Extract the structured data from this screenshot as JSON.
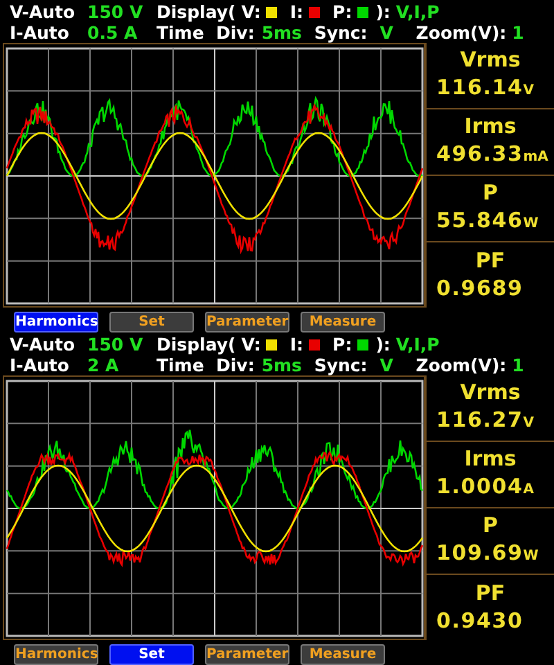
{
  "panels": [
    {
      "v_range_label": "V-Auto",
      "v_range": "150 V",
      "display_open": "Display(",
      "legend": [
        {
          "label": "V:",
          "color": "#f0e000"
        },
        {
          "label": "I:",
          "color": "#e80000"
        },
        {
          "label": "P:",
          "color": "#00d800"
        }
      ],
      "display_close": "):",
      "display_value": "V,I,P",
      "i_range_label": "I-Auto",
      "i_range": "0.5 A",
      "time_div_label": "Time  Div:",
      "time_div": "5ms",
      "sync_label": "Sync:",
      "sync": "V",
      "zoom_label": "Zoom(V):",
      "zoom": "1",
      "readings": [
        {
          "name": "Vrms",
          "value": "116.14",
          "unit": "V"
        },
        {
          "name": "Irms",
          "value": "496.33",
          "unit": "mA"
        },
        {
          "name": "P",
          "value": "55.846",
          "unit": "W"
        },
        {
          "name": "PF",
          "value": "0.9689"
        }
      ],
      "buttons": [
        {
          "label": "Harmonics",
          "selected": true
        },
        {
          "label": "Set",
          "selected": false
        },
        {
          "label": "Parameter",
          "selected": false
        },
        {
          "label": "Measure",
          "selected": false
        }
      ]
    },
    {
      "v_range_label": "V-Auto",
      "v_range": "150 V",
      "display_open": "Display(",
      "legend": [
        {
          "label": "V:",
          "color": "#f0e000"
        },
        {
          "label": "I:",
          "color": "#e80000"
        },
        {
          "label": "P:",
          "color": "#00d800"
        }
      ],
      "display_close": "):",
      "display_value": "V,I,P",
      "i_range_label": "I-Auto",
      "i_range": "2 A",
      "time_div_label": "Time  Div:",
      "time_div": "5ms",
      "sync_label": "Sync:",
      "sync": "V",
      "zoom_label": "Zoom(V):",
      "zoom": "1",
      "readings": [
        {
          "name": "Vrms",
          "value": "116.27",
          "unit": "V"
        },
        {
          "name": "Irms",
          "value": "1.0004",
          "unit": "A"
        },
        {
          "name": "P",
          "value": "109.69",
          "unit": "W"
        },
        {
          "name": "PF",
          "value": "0.9430"
        }
      ],
      "buttons": [
        {
          "label": "Harmonics",
          "selected": false
        },
        {
          "label": "Set",
          "selected": true
        },
        {
          "label": "Parameter",
          "selected": false
        },
        {
          "label": "Measure",
          "selected": false
        }
      ]
    }
  ]
}
